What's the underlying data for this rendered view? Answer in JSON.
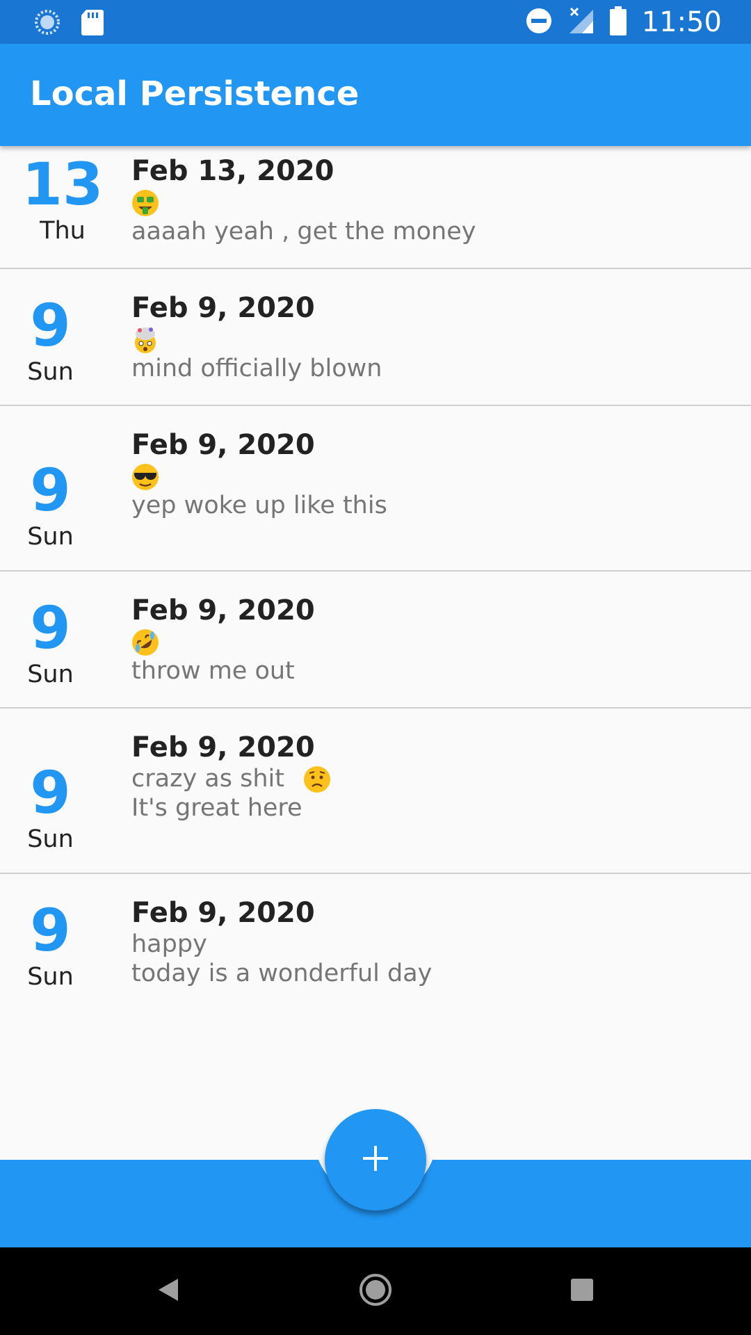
{
  "status_bar": {
    "time": "11:50",
    "icons": [
      "sync-icon",
      "sd-card-icon",
      "do-not-disturb-icon",
      "no-signal-icon",
      "battery-icon"
    ]
  },
  "app_bar": {
    "title": "Local Persistence"
  },
  "entries": [
    {
      "day": "13",
      "weekday": "Thu",
      "date": "Feb 13, 2020",
      "mood_icon": "money-mouth-face-icon",
      "note": "aaaah yeah , get the money"
    },
    {
      "day": "9",
      "weekday": "Sun",
      "date": "Feb 9, 2020",
      "mood_icon": "exploding-head-icon",
      "note": "mind officially blown"
    },
    {
      "day": "9",
      "weekday": "Sun",
      "date": "Feb 9, 2020",
      "mood_icon": "sunglasses-face-icon",
      "note": "yep woke up like this"
    },
    {
      "day": "9",
      "weekday": "Sun",
      "date": "Feb 9, 2020",
      "mood_icon": "rolling-on-floor-laughing-icon",
      "note": "throw me out"
    },
    {
      "day": "9",
      "weekday": "Sun",
      "date": "Feb 9, 2020",
      "mood_text": "crazy as shit",
      "mood_icon": "worried-face-icon",
      "note": "It's great here"
    },
    {
      "day": "9",
      "weekday": "Sun",
      "date": "Feb 9, 2020",
      "mood_text": "happy",
      "note": "today is a wonderful day"
    }
  ],
  "fab": {
    "icon": "plus-icon"
  },
  "nav_bar": {
    "buttons": [
      "back-icon",
      "home-icon",
      "recents-icon"
    ]
  },
  "colors": {
    "primary": "#2196f3",
    "status_bar": "#1976d2",
    "background": "#fafafa"
  }
}
